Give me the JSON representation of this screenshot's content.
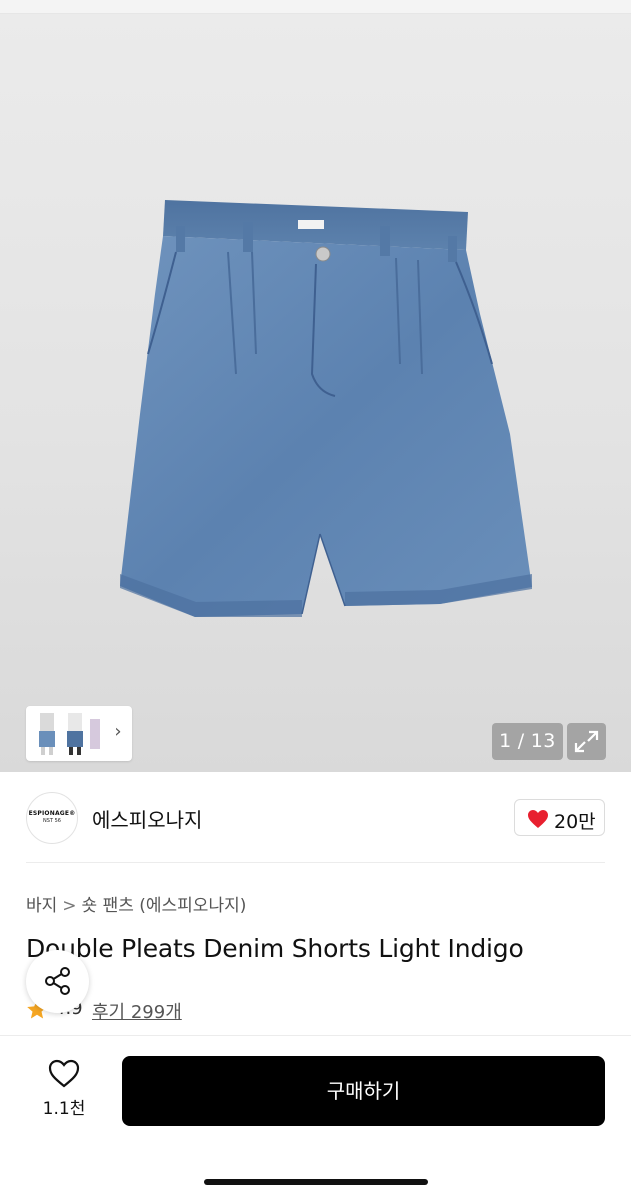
{
  "gallery": {
    "image_alt": "Double Pleats Denim Shorts Light Indigo",
    "current": "1",
    "total": "13",
    "counter_separator": "/",
    "thumbnails_chevron_icon": "chevron-right-icon",
    "expand_icon": "expand-arrows-icon"
  },
  "brand": {
    "name": "에스피오나지",
    "logo_line1": "ESPIONAGE®",
    "logo_line2": "NST 56"
  },
  "brand_likes": {
    "icon": "heart-filled-icon",
    "count": "20만",
    "color": "#e8202f"
  },
  "breadcrumb": {
    "items": [
      "바지",
      "숏 팬츠 (에스피오나지)"
    ],
    "separator": ">"
  },
  "product": {
    "title": "Double Pleats Denim Shorts Light Indigo"
  },
  "rating": {
    "icon": "star-icon",
    "score": "4.9",
    "reviews_label": "후기 299개",
    "star_color": "#f5a623"
  },
  "share": {
    "icon": "share-icon"
  },
  "bottom_bar": {
    "wish_icon": "heart-outline-icon",
    "wish_count": "1.1천",
    "buy_label": "구매하기",
    "buy_color": "#000000"
  }
}
